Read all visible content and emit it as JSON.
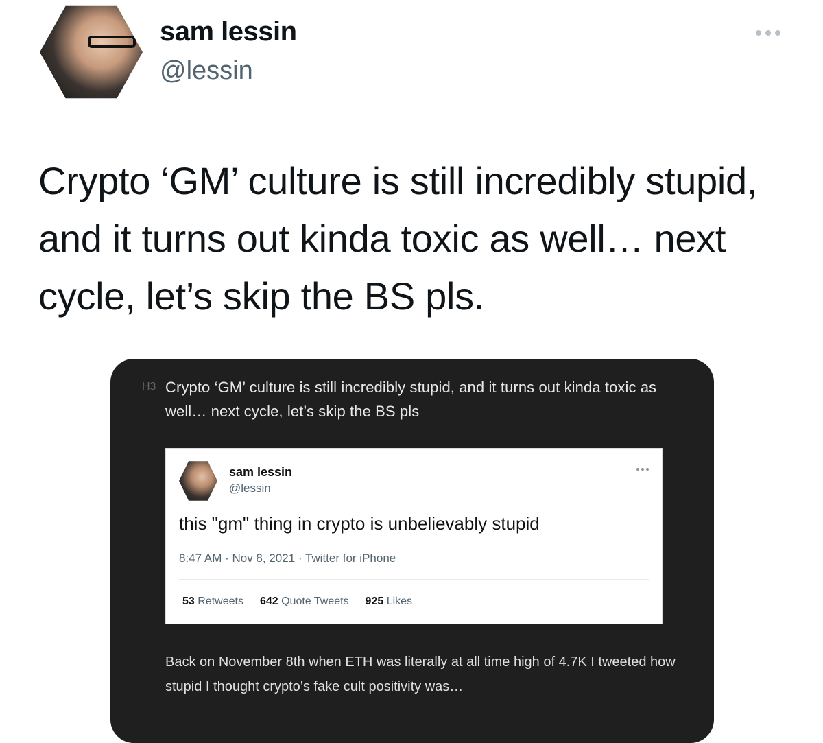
{
  "tweet": {
    "display_name": "sam lessin",
    "handle": "@lessin",
    "text": "Crypto ‘GM’ culture is still incredibly stupid, and it turns out kinda toxic as well… next cycle, let’s skip the BS pls."
  },
  "media": {
    "heading_level": "H3",
    "heading": "Crypto ‘GM’ culture is still incredibly stupid, and it turns out kinda toxic as well… next cycle, let’s skip the BS pls",
    "embedded_tweet": {
      "display_name": "sam lessin",
      "handle": "@lessin",
      "text": "this \"gm\" thing in crypto is unbelievably stupid",
      "meta": "8:47 AM · Nov 8, 2021 · Twitter for iPhone",
      "stats": [
        {
          "count": "53",
          "label": "Retweets"
        },
        {
          "count": "642",
          "label": "Quote Tweets"
        },
        {
          "count": "925",
          "label": "Likes"
        }
      ]
    },
    "body": "Back on November 8th when ETH was literally at all time high of 4.7K I tweeted how stupid I thought crypto’s fake cult positivity was…"
  },
  "icons": {
    "more": "more-options-icon"
  }
}
